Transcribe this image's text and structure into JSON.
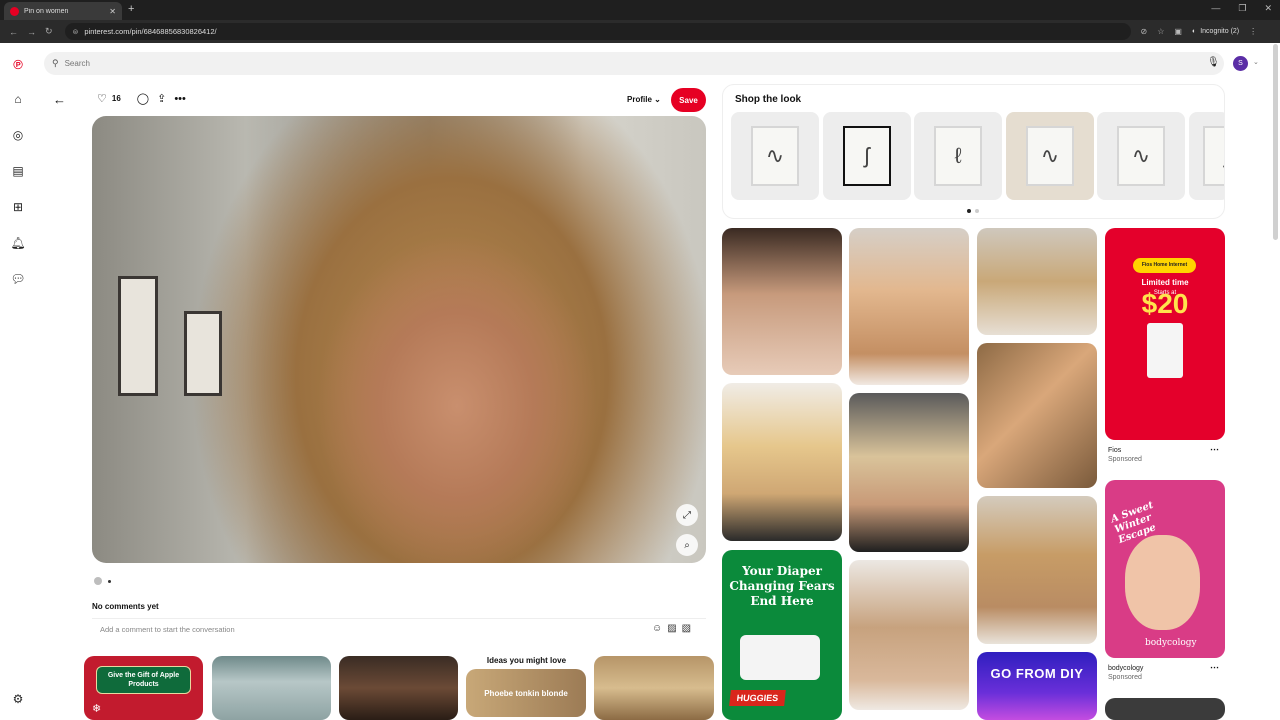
{
  "browser": {
    "tab_title": "Pin on women",
    "new_tab": "+",
    "url": "pinterest.com/pin/68468856830826412/",
    "incognito_label": "Incognito (2)"
  },
  "search": {
    "placeholder": "Search"
  },
  "user": {
    "avatar_initial": "S"
  },
  "pin": {
    "like_count": "16",
    "profile_label": "Profile",
    "save_label": "Save",
    "no_comments": "No comments yet",
    "comment_placeholder": "Add a comment to start the conversation"
  },
  "shop": {
    "title": "Shop the look",
    "products": [
      {
        "name": "line-art-print-1"
      },
      {
        "name": "line-art-print-2"
      },
      {
        "name": "line-art-print-3"
      },
      {
        "name": "line-art-print-4"
      },
      {
        "name": "line-art-print-5"
      },
      {
        "name": "line-art-print-6"
      }
    ]
  },
  "ads": {
    "fios": {
      "tag": "Fios Home Internet",
      "headline": "Limited time",
      "sub": "Starts at",
      "price": "$20",
      "name": "Fios",
      "sponsored": "Sponsored"
    },
    "huggies": {
      "headline": "Your Diaper Changing Fears End Here",
      "brand": "HUGGIES"
    },
    "bodycology": {
      "headline": "A Sweet Winter Escape",
      "brand": "bodycology",
      "name": "bodycology",
      "sponsored": "Sponsored"
    },
    "diy": {
      "headline": "GO FROM DIY"
    },
    "apple": {
      "headline": "Give the Gift of Apple Products"
    }
  },
  "ideas": {
    "title": "Ideas you might love",
    "item": "Phoebe tonkin blonde"
  },
  "colors": {
    "brand_red": "#e60023",
    "avatar": "#5b2ea6"
  }
}
